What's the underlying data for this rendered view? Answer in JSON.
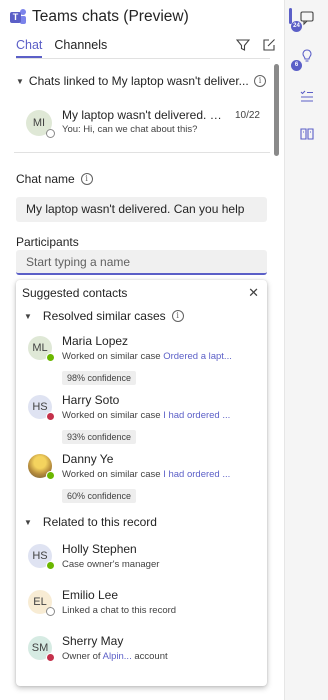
{
  "header": {
    "title": "Teams chats (Preview)"
  },
  "tabs": [
    {
      "label": "Chat"
    },
    {
      "label": "Channels"
    }
  ],
  "chat_group": {
    "title": "Chats linked to My laptop wasn't deliver...",
    "chats": [
      {
        "initials": "MI",
        "title": "My laptop wasn't delivered. C...",
        "date": "10/22",
        "preview": "You: Hi, can we chat about this?"
      }
    ]
  },
  "chat_name": {
    "label": "Chat name",
    "value": "My laptop wasn't delivered. Can you help"
  },
  "participants": {
    "label": "Participants",
    "placeholder": "Start typing a name"
  },
  "suggested": {
    "title": "Suggested contacts",
    "resolved_title": "Resolved similar cases",
    "related_title": "Related to this record",
    "resolved": [
      {
        "initials": "ML",
        "name": "Maria Lopez",
        "text": "Worked on similar case",
        "link": "Ordered a lapt...",
        "confidence": "98% confidence",
        "status": "available"
      },
      {
        "initials": "HS",
        "name": "Harry Soto",
        "text": "Worked on similar case",
        "link": "I had ordered ...",
        "confidence": "93% confidence",
        "status": "busy"
      },
      {
        "initials": "",
        "name": "Danny Ye",
        "text": "Worked on similar case",
        "link": "I had ordered ...",
        "confidence": "60% confidence",
        "status": "available"
      }
    ],
    "related": [
      {
        "initials": "HS",
        "name": "Holly Stephen",
        "text": "Case owner's manager",
        "status": "available"
      },
      {
        "initials": "EL",
        "name": "Emilio Lee",
        "text": "Linked a chat to this record",
        "status": "offline"
      },
      {
        "initials": "SM",
        "name": "Sherry May",
        "text_before": "Owner of",
        "link": "Alpin...",
        "text_after": "account",
        "status": "busy"
      }
    ]
  },
  "rail": {
    "badge_top": "24",
    "badge_second": "6"
  },
  "colors": {
    "accent": "#5b5fc7",
    "available": "#6bb700",
    "busy": "#c4314b"
  }
}
